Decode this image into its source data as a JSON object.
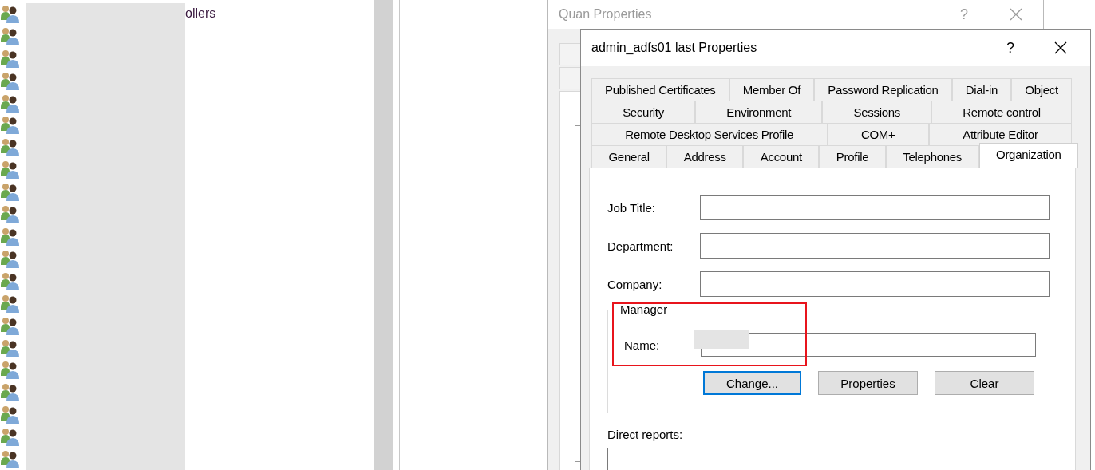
{
  "left_pane": {
    "items": [
      {
        "kind": "group",
        "label": "ollers"
      },
      {
        "kind": "group"
      },
      {
        "kind": "group"
      },
      {
        "kind": "group"
      },
      {
        "kind": "group"
      },
      {
        "kind": "group"
      },
      {
        "kind": "group"
      },
      {
        "kind": "group"
      },
      {
        "kind": "group"
      },
      {
        "kind": "group"
      },
      {
        "kind": "group"
      },
      {
        "kind": "group"
      },
      {
        "kind": "group"
      },
      {
        "kind": "group"
      },
      {
        "kind": "group"
      },
      {
        "kind": "group"
      },
      {
        "kind": "group"
      },
      {
        "kind": "group"
      },
      {
        "kind": "group"
      },
      {
        "kind": "group"
      },
      {
        "kind": "group"
      }
    ]
  },
  "back_window": {
    "title": "Quan Properties",
    "help_button": "?"
  },
  "dialog": {
    "title": "admin_adfs01 last Properties",
    "help_button": "?",
    "tab_rows": [
      [
        {
          "label": "Published Certificates",
          "selected": false
        },
        {
          "label": "Member Of",
          "selected": false
        },
        {
          "label": "Password Replication",
          "selected": false
        },
        {
          "label": "Dial-in",
          "selected": false
        },
        {
          "label": "Object",
          "selected": false
        }
      ],
      [
        {
          "label": "Security",
          "selected": false
        },
        {
          "label": "Environment",
          "selected": false
        },
        {
          "label": "Sessions",
          "selected": false
        },
        {
          "label": "Remote control",
          "selected": false
        }
      ],
      [
        {
          "label": "Remote Desktop Services Profile",
          "selected": false
        },
        {
          "label": "COM+",
          "selected": false
        },
        {
          "label": "Attribute Editor",
          "selected": false
        }
      ],
      [
        {
          "label": "General",
          "selected": false
        },
        {
          "label": "Address",
          "selected": false
        },
        {
          "label": "Account",
          "selected": false
        },
        {
          "label": "Profile",
          "selected": false
        },
        {
          "label": "Telephones",
          "selected": false
        },
        {
          "label": "Organization",
          "selected": true
        }
      ]
    ],
    "fields": [
      {
        "label": "Job Title:"
      },
      {
        "label": "Department:"
      },
      {
        "label": "Company:"
      }
    ],
    "manager": {
      "legend": "Manager",
      "name_label": "Name:",
      "buttons": [
        {
          "label": "Change...",
          "default": true
        },
        {
          "label": "Properties",
          "default": false
        },
        {
          "label": "Clear",
          "default": false
        }
      ]
    },
    "direct_reports_label": "Direct reports:"
  }
}
